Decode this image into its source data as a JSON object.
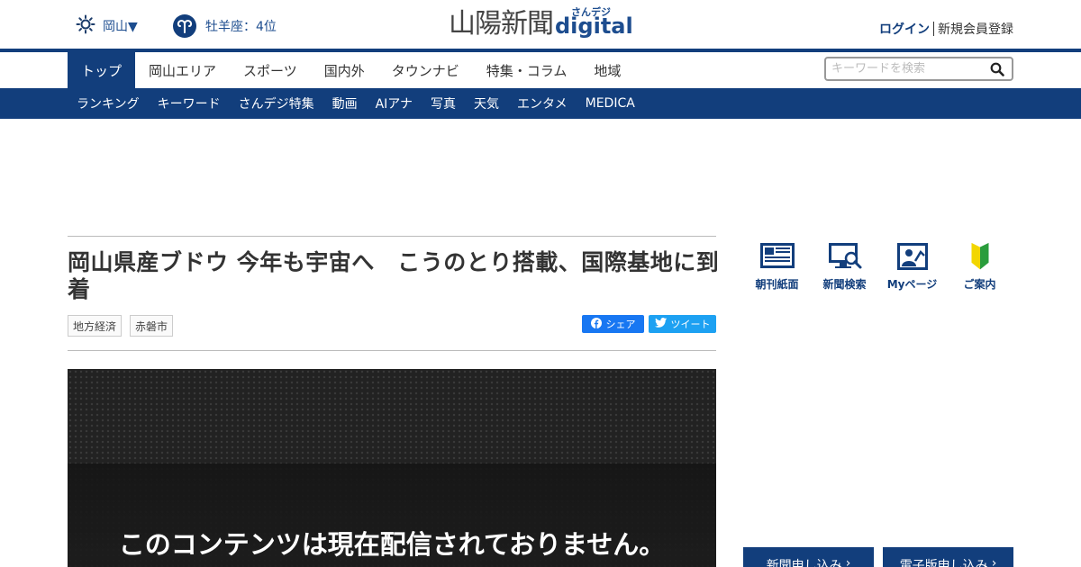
{
  "header": {
    "weather": {
      "region": "岡山▼",
      "icon": "sun-icon"
    },
    "horoscope": {
      "text": "牡羊座：4位",
      "icon": "aries-icon"
    },
    "logo": {
      "jp": "山陽新聞",
      "sub": "さんデジ",
      "digital": "digital"
    },
    "auth": {
      "login": "ログイン",
      "register": "新規会員登録"
    }
  },
  "main_nav": {
    "items": [
      "トップ",
      "岡山エリア",
      "スポーツ",
      "国内外",
      "タウンナビ",
      "特集・コラム",
      "地域"
    ],
    "active_index": 0
  },
  "search": {
    "placeholder": "キーワードを検索",
    "icon": "search-icon"
  },
  "sub_nav": {
    "items": [
      "ランキング",
      "キーワード",
      "さんデジ特集",
      "動画",
      "AIアナ",
      "写真",
      "天気",
      "エンタメ",
      "MEDICA"
    ]
  },
  "article": {
    "title": "岡山県産ブドウ 今年も宇宙へ　こうのとり搭載、国際基地に到着",
    "tags": [
      "地方経済",
      "赤磐市"
    ],
    "share_label": "シェア",
    "tweet_label": "ツイート",
    "video_message": "このコンテンツは現在配信されておりません。"
  },
  "sidebar": {
    "quick_links": [
      {
        "label": "朝刊紙面",
        "icon": "newspaper-icon"
      },
      {
        "label": "新聞検索",
        "icon": "search-monitor-icon"
      },
      {
        "label": "Myページ",
        "icon": "mypage-icon"
      },
      {
        "label": "ご案内",
        "icon": "beginner-mark-icon"
      }
    ],
    "apply_buttons": [
      "新聞申し込み",
      "電子版申し込み"
    ]
  },
  "colors": {
    "brand_navy": "#123e7c",
    "facebook": "#1877f2",
    "twitter": "#1da1f2"
  }
}
